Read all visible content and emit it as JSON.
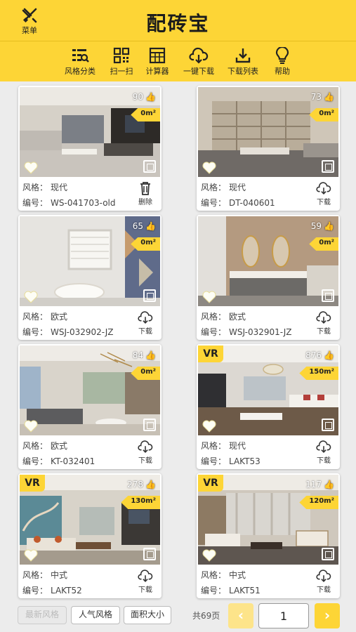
{
  "header": {
    "menu_label": "菜单",
    "title": "配砖宝"
  },
  "toolbar": {
    "items": [
      {
        "label": "风格分类",
        "icon": "style-filter-icon"
      },
      {
        "label": "扫一扫",
        "icon": "qr-scan-icon"
      },
      {
        "label": "计算器",
        "icon": "calculator-icon"
      },
      {
        "label": "一键下载",
        "icon": "cloud-download-icon"
      },
      {
        "label": "下载列表",
        "icon": "download-tray-icon"
      },
      {
        "label": "帮助",
        "icon": "lightbulb-icon"
      }
    ]
  },
  "cards": [
    {
      "likes": "90",
      "area": "0m²",
      "vr": "",
      "style_label": "风格：",
      "style": "现代",
      "code_label": "编号：",
      "code": "WS-041703-old",
      "action": "删除",
      "action_icon": "trash-icon"
    },
    {
      "likes": "73",
      "area": "0m²",
      "vr": "",
      "style_label": "风格：",
      "style": "现代",
      "code_label": "编号：",
      "code": "DT-040601",
      "action": "下载",
      "action_icon": "cloud-download-icon"
    },
    {
      "likes": "65",
      "area": "0m²",
      "vr": "",
      "style_label": "风格：",
      "style": "欧式",
      "code_label": "编号：",
      "code": "WSJ-032902-JZ",
      "action": "下载",
      "action_icon": "cloud-download-icon"
    },
    {
      "likes": "59",
      "area": "0m²",
      "vr": "",
      "style_label": "风格：",
      "style": "欧式",
      "code_label": "编号：",
      "code": "WSJ-032901-JZ",
      "action": "下载",
      "action_icon": "cloud-download-icon"
    },
    {
      "likes": "84",
      "area": "0m²",
      "vr": "",
      "style_label": "风格：",
      "style": "欧式",
      "code_label": "编号：",
      "code": "KT-032401",
      "action": "下载",
      "action_icon": "cloud-download-icon"
    },
    {
      "likes": "876",
      "area": "150m²",
      "vr": "VR",
      "style_label": "风格：",
      "style": "现代",
      "code_label": "编号：",
      "code": "LAKT53",
      "action": "下载",
      "action_icon": "cloud-download-icon"
    },
    {
      "likes": "278",
      "area": "130m²",
      "vr": "VR",
      "style_label": "风格：",
      "style": "中式",
      "code_label": "编号：",
      "code": "LAKT52",
      "action": "下载",
      "action_icon": "cloud-download-icon"
    },
    {
      "likes": "117",
      "area": "120m²",
      "vr": "VR",
      "style_label": "风格：",
      "style": "中式",
      "code_label": "编号：",
      "code": "LAKT51",
      "action": "下载",
      "action_icon": "cloud-download-icon"
    }
  ],
  "bottom": {
    "sort_options": [
      {
        "label": "最新风格",
        "active": true
      },
      {
        "label": "人气风格",
        "active": false
      },
      {
        "label": "面积大小",
        "active": false
      }
    ],
    "total_pages": "共69页",
    "prev": "‹",
    "next": "›",
    "current_page": "1"
  },
  "colors": {
    "accent": "#fdd536",
    "background": "#ececec"
  }
}
